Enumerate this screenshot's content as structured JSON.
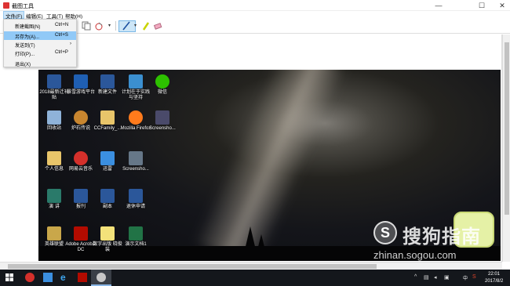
{
  "window": {
    "title": "截图工具",
    "minimize": "—",
    "maximize": "☐",
    "close": "✕"
  },
  "menubar": {
    "items": [
      "文件(F)",
      "编辑(E)",
      "工具(T)",
      "帮助(H)"
    ]
  },
  "file_menu": {
    "items": [
      {
        "label": "新建截图(N)",
        "shortcut": "Ctrl+N"
      },
      {
        "label": "另存为(A)...",
        "shortcut": "Ctrl+S"
      },
      {
        "label": "发送到(T)",
        "shortcut": "",
        "submenu_arrow": "›"
      },
      {
        "label": "打印(P)...",
        "shortcut": "Ctrl+P"
      },
      {
        "label": "退出(X)",
        "shortcut": ""
      }
    ],
    "highlighted_index": 1
  },
  "desktop_icons": [
    {
      "label": "2018最新迁补贴",
      "icon": "word-doc-icon",
      "color": "#2b579a"
    },
    {
      "label": "暴雪游戏平台",
      "icon": "battlenet-icon",
      "color": "#1f5fb3"
    },
    {
      "label": "新建文件",
      "icon": "word-doc-icon",
      "color": "#2b579a"
    },
    {
      "label": "计划在于实践与坚持",
      "icon": "slides-icon",
      "color": "#3b8fd0"
    },
    {
      "label": "微信",
      "icon": "wechat-icon",
      "color": "#2dc100"
    },
    {
      "label": "回收站",
      "icon": "recycle-bin-icon",
      "color": "#8fb3d9"
    },
    {
      "label": "炉石传说",
      "icon": "hearthstone-icon",
      "color": "#c8862f"
    },
    {
      "label": "CCFamily_...",
      "icon": "folder-icon",
      "color": "#e8c56a"
    },
    {
      "label": "Mozilla Firefox",
      "icon": "firefox-icon",
      "color": "#ff7b1c"
    },
    {
      "label": "Screensho...",
      "icon": "image-file-icon",
      "color": "#4a4a6a"
    },
    {
      "label": "个人信息",
      "icon": "folder-icon",
      "color": "#e8c56a"
    },
    {
      "label": "网易云音乐",
      "icon": "netease-music-icon",
      "color": "#d4302b"
    },
    {
      "label": "迅雷",
      "icon": "xunlei-icon",
      "color": "#3b8fe0"
    },
    {
      "label": "Screensho...",
      "icon": "image-file-icon",
      "color": "#667788"
    },
    {
      "label": "演  讲",
      "icon": "slides-icon",
      "color": "#2a7a6a"
    },
    {
      "label": "报刊",
      "icon": "word-doc-icon",
      "color": "#2b579a"
    },
    {
      "label": "副本",
      "icon": "word-doc-icon",
      "color": "#2b579a"
    },
    {
      "label": "退休申请",
      "icon": "word-doc-icon",
      "color": "#2b579a"
    },
    {
      "label": "英雄联盟",
      "icon": "lol-icon",
      "color": "#c9a74a"
    },
    {
      "label": "Adobe Acrobat DC",
      "icon": "acrobat-icon",
      "color": "#b30b00"
    },
    {
      "label": "数字出版 晓俊装",
      "icon": "document-icon",
      "color": "#f3e27a"
    },
    {
      "label": "演示文档1",
      "icon": "excel-doc-icon",
      "color": "#217346"
    }
  ],
  "watermark": {
    "text": "搜狗指南",
    "letter": "S",
    "url": "zhinan.sogou.com"
  },
  "taskbar": {
    "time": "22:01",
    "date": "2017/8/2",
    "ime": "中",
    "icons": [
      "windows-start-icon",
      "netease-music-icon",
      "xunlei-icon",
      "edge-icon",
      "acrobat-icon",
      "snipping-tool-icon"
    ]
  }
}
